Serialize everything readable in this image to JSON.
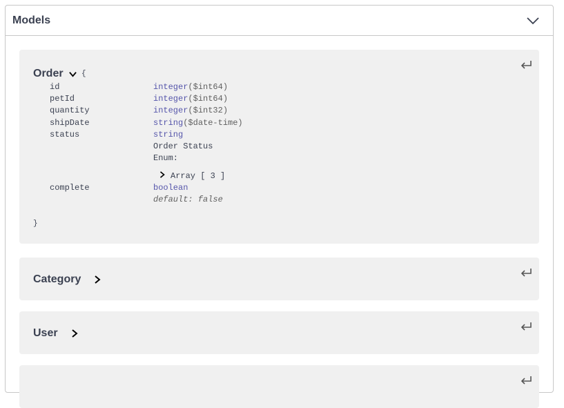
{
  "section": {
    "title": "Models"
  },
  "models": {
    "order": {
      "name": "Order",
      "open_brace": "{",
      "close_brace": "}",
      "properties": [
        {
          "name": "id",
          "type": "integer",
          "format": "($int64)"
        },
        {
          "name": "petId",
          "type": "integer",
          "format": "($int64)"
        },
        {
          "name": "quantity",
          "type": "integer",
          "format": "($int32)"
        },
        {
          "name": "shipDate",
          "type": "string",
          "format": "($date-time)"
        },
        {
          "name": "status",
          "type": "string",
          "format": ""
        },
        {
          "name": "complete",
          "type": "boolean",
          "format": ""
        }
      ],
      "status_description": "Order Status",
      "enum_label": "Enum:",
      "array_label": "Array [ 3 ]",
      "complete_default": "default: false"
    },
    "category": {
      "name": "Category"
    },
    "user": {
      "name": "User"
    }
  },
  "icons": {
    "collapse": "chevron-down-icon",
    "expand": "chevron-right-icon",
    "return": "return-arrow-icon"
  }
}
